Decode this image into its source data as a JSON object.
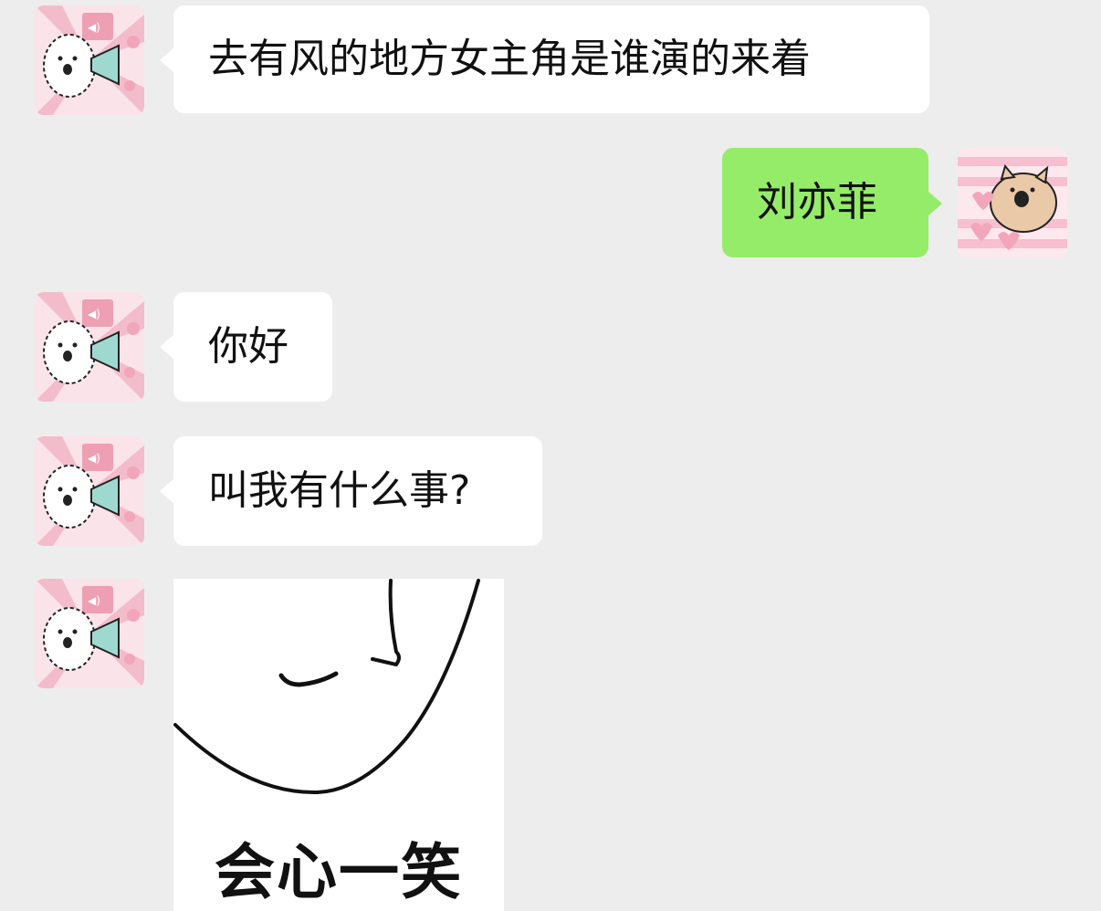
{
  "chat": {
    "messages": [
      {
        "sender": "other",
        "text": "去有风的地方女主角是谁演的来着"
      },
      {
        "sender": "me",
        "text": "刘亦菲"
      },
      {
        "sender": "other",
        "text": "你好"
      },
      {
        "sender": "other",
        "text": "叫我有什么事?"
      },
      {
        "sender": "other",
        "sticker_caption": "会心一笑"
      }
    ]
  },
  "avatars": {
    "other": "bunny-megaphone-avatar",
    "me": "cat-hearts-avatar"
  },
  "colors": {
    "background": "#ededed",
    "incoming_bubble": "#ffffff",
    "outgoing_bubble": "#95ec69",
    "avatar_pink": "#f6c9d4"
  }
}
